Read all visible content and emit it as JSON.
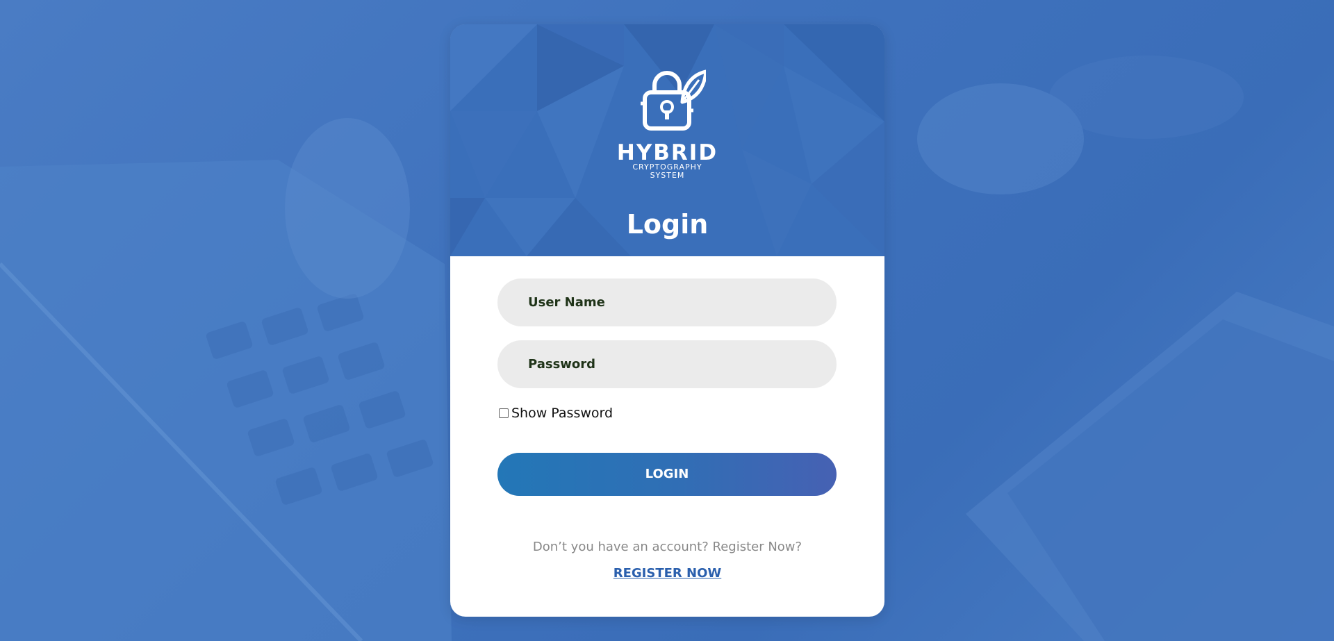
{
  "brand": {
    "name": "HYBRID",
    "subtitle_line1": "CRYPTOGRAPHY",
    "subtitle_line2": "SYSTEM",
    "logo_icon": "padlock-leaf-icon"
  },
  "page": {
    "title": "Login"
  },
  "form": {
    "username_placeholder": "User Name",
    "username_value": "",
    "password_placeholder": "Password",
    "password_value": "",
    "show_password_label": "Show Password",
    "show_password_checked": false,
    "login_button": "LOGIN"
  },
  "footer": {
    "prompt": "Don’t you have an account? Register Now?",
    "register_link": "REGISTER NOW"
  },
  "colors": {
    "background": "#3f72bd",
    "header": "#3a6fba",
    "field_bg": "#ebebeb",
    "button_start": "#2377b7",
    "button_end": "#4661b3",
    "link": "#2a5fad"
  }
}
